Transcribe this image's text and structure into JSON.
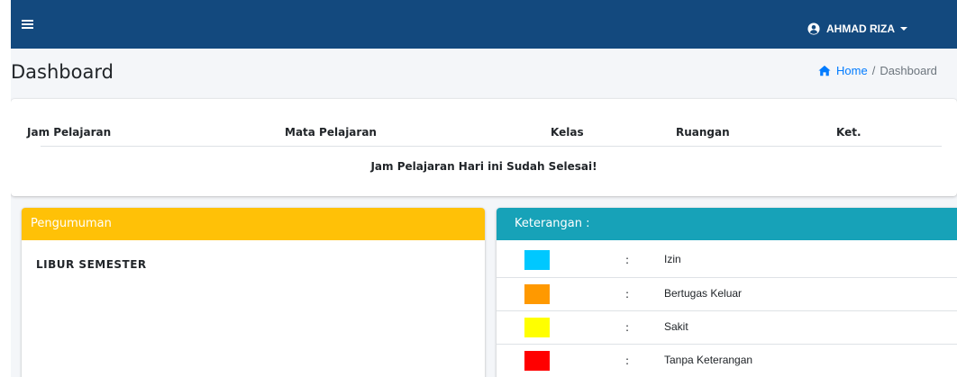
{
  "navbar": {
    "menu_icon": "hamburger-icon",
    "user_icon": "user-circle-icon",
    "user_name": "AHMAD RIZA",
    "bg_color": "#13497e"
  },
  "page": {
    "title": "Dashboard",
    "breadcrumb": {
      "home_icon": "home-icon",
      "home_label": "Home",
      "separator": "/",
      "current": "Dashboard"
    }
  },
  "schedule": {
    "columns": [
      "Jam Pelajaran",
      "Mata Pelajaran",
      "Kelas",
      "Ruangan",
      "Ket."
    ],
    "empty_message": "Jam Pelajaran Hari ini Sudah Selesai!"
  },
  "announcement": {
    "header": "Pengumuman",
    "header_color": "#ffc107",
    "text": "LIBUR SEMESTER"
  },
  "legend": {
    "header": "Keterangan :",
    "header_color": "#17a2b8",
    "items": [
      {
        "color": "#00c8ff",
        "colon": ":",
        "label": "Izin"
      },
      {
        "color": "#ff9900",
        "colon": ":",
        "label": "Bertugas Keluar"
      },
      {
        "color": "#ffff00",
        "colon": ":",
        "label": "Sakit"
      },
      {
        "color": "#ff0000",
        "colon": ":",
        "label": "Tanpa Keterangan"
      }
    ]
  }
}
